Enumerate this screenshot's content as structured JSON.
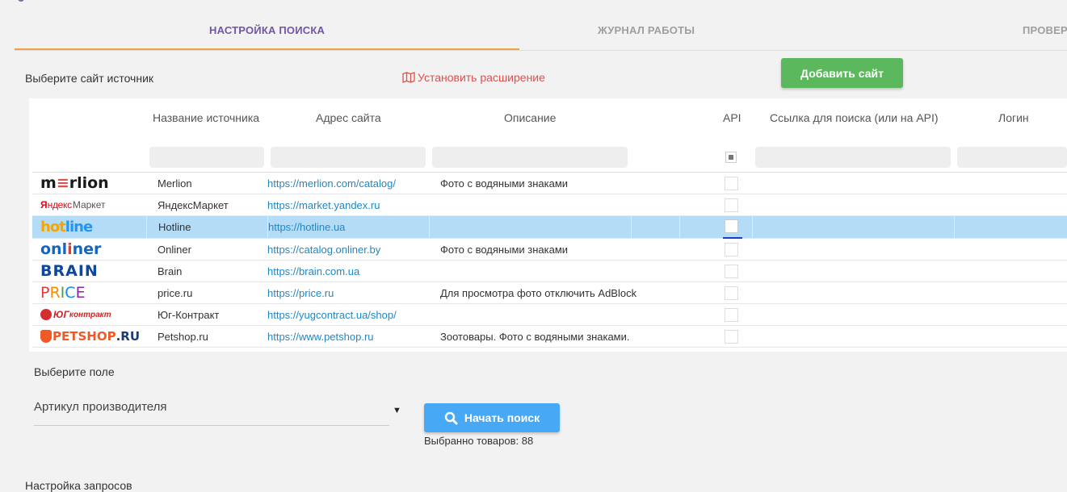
{
  "tabs": [
    {
      "label": "НАСТРОЙКА ПОИСКА",
      "active": true
    },
    {
      "label": "ЖУРНАЛ РАБОТЫ",
      "active": false
    },
    {
      "label": "ПРОВЕР",
      "active": false
    }
  ],
  "source_section": {
    "title": "Выберите сайт источник",
    "install_extension": "Установить расширение",
    "add_site_button": "Добавить сайт"
  },
  "table": {
    "headers": [
      "Название источника",
      "Адрес сайта",
      "Описание",
      "API",
      "Ссылка для поиска (или на API)",
      "Логин"
    ],
    "rows": [
      {
        "logo": "merlion",
        "name": "Merlion",
        "url": "https://merlion.com/catalog/",
        "description": "Фото с водяными знаками",
        "selected": false
      },
      {
        "logo": "Яндекс Маркет",
        "name": "ЯндексМаркет",
        "url": "https://market.yandex.ru",
        "description": "",
        "selected": false
      },
      {
        "logo": "hotline",
        "name": "Hotline",
        "url": "https://hotline.ua",
        "description": "",
        "selected": true
      },
      {
        "logo": "onliner",
        "name": "Onliner",
        "url": "https://catalog.onliner.by",
        "description": "Фото с водяными знаками",
        "selected": false
      },
      {
        "logo": "BRAIN",
        "name": "Brain",
        "url": "https://brain.com.ua",
        "description": "",
        "selected": false
      },
      {
        "logo": "PRICE",
        "name": "price.ru",
        "url": "https://price.ru",
        "description": "Для просмотра фото отключить AdBlock",
        "selected": false
      },
      {
        "logo": "Юг контракт",
        "name": "Юг-Контракт",
        "url": "https://yugcontract.ua/shop/",
        "description": "",
        "selected": false
      },
      {
        "logo": "PETSHOP.RU",
        "name": "Petshop.ru",
        "url": "https://www.petshop.ru",
        "description": "Зоотовары. Фото с водяными знаками.",
        "selected": false
      }
    ]
  },
  "field_section": {
    "title": "Выберите поле",
    "selected_field": "Артикул производителя",
    "search_button": "Начать поиск",
    "selected_count": "Выбранно товаров: 88"
  },
  "requests_section": {
    "title": "Настройка запросов"
  },
  "colors": {
    "active_tab": "#7256a8",
    "tab_underline": "#f0a24b",
    "add_button": "#5cb85c",
    "search_button": "#47a9f5",
    "link": "#1e88c7",
    "selected_row": "#b5dcf7",
    "extension_link": "#d9534f"
  }
}
